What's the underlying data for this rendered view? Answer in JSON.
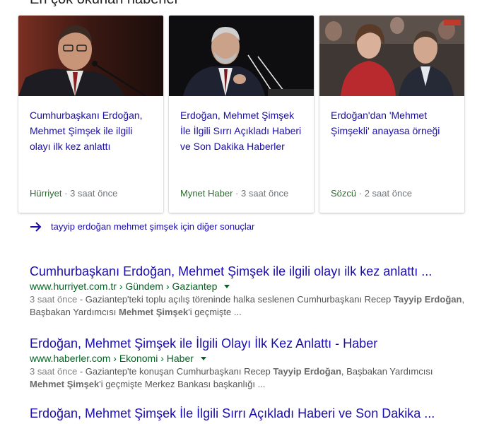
{
  "top_stories": {
    "heading": "En çok okunan haberler",
    "cards": [
      {
        "title": "Cumhurbaşkanı Erdoğan, Mehmet Şimşek ile ilgili olayı ilk kez anlattı",
        "source": "Hürriyet",
        "time": "3 saat önce",
        "image": "man-speaking-at-microphone-photo"
      },
      {
        "title": "Erdoğan, Mehmet Şimşek İle İlgili Sırrı Açıkladı Haberi ve Son Dakika Haberler",
        "source": "Mynet Haber",
        "time": "3 saat önce",
        "image": "man-at-podium-photo"
      },
      {
        "title": "Erdoğan'dan 'Mehmet Şimşekli' anayasa örneği",
        "source": "Sözcü",
        "time": "2 saat önce",
        "image": "seated-crowd-photo"
      }
    ]
  },
  "more_results": {
    "label": "tayyip erdoğan mehmet şimşek için diğer sonuçlar",
    "icon": "arrow-right-icon"
  },
  "results": [
    {
      "title": "Cumhurbaşkanı Erdoğan, Mehmet Şimşek ile ilgili olayı ilk kez anlattı ...",
      "url_parts": [
        "www.hurriyet.com.tr",
        "Gündem",
        "Gaziantep"
      ],
      "time": "3 saat önce",
      "snippet_1": "- Gaziantep'teki toplu açılış töreninde halka seslenen Cumhurbaşkanı Recep ",
      "snippet_b1": "Tayyip",
      "snippet_b2": "Erdoğan",
      "snippet_2": ", Başbakan Yardımcısı ",
      "snippet_b3": "Mehmet Şimşek",
      "snippet_3": "'i geçmişte ..."
    },
    {
      "title": "Erdoğan, Mehmet Şimşek ile İlgili Olayı İlk Kez Anlattı - Haber",
      "url_parts": [
        "www.haberler.com",
        "Ekonomi",
        "Haber"
      ],
      "time": "3 saat önce",
      "snippet_1": "- Gaziantep'te konuşan Cumhurbaşkanı Recep ",
      "snippet_b1": "Tayyip Erdoğan",
      "snippet_2": ", Başbakan Yardımcısı",
      "snippet_b2": "Mehmet Şimşek",
      "snippet_3": "'i geçmişte Merkez Bankası başkanlığı ..."
    },
    {
      "title": "Erdoğan, Mehmet Şimşek İle İlgili Sırrı Açıkladı Haberi ve Son Dakika ..."
    }
  ],
  "colors": {
    "link": "#1a0dab",
    "url": "#006621",
    "snippet": "#545454",
    "meta": "#70757a",
    "source": "#2e6b2e"
  }
}
